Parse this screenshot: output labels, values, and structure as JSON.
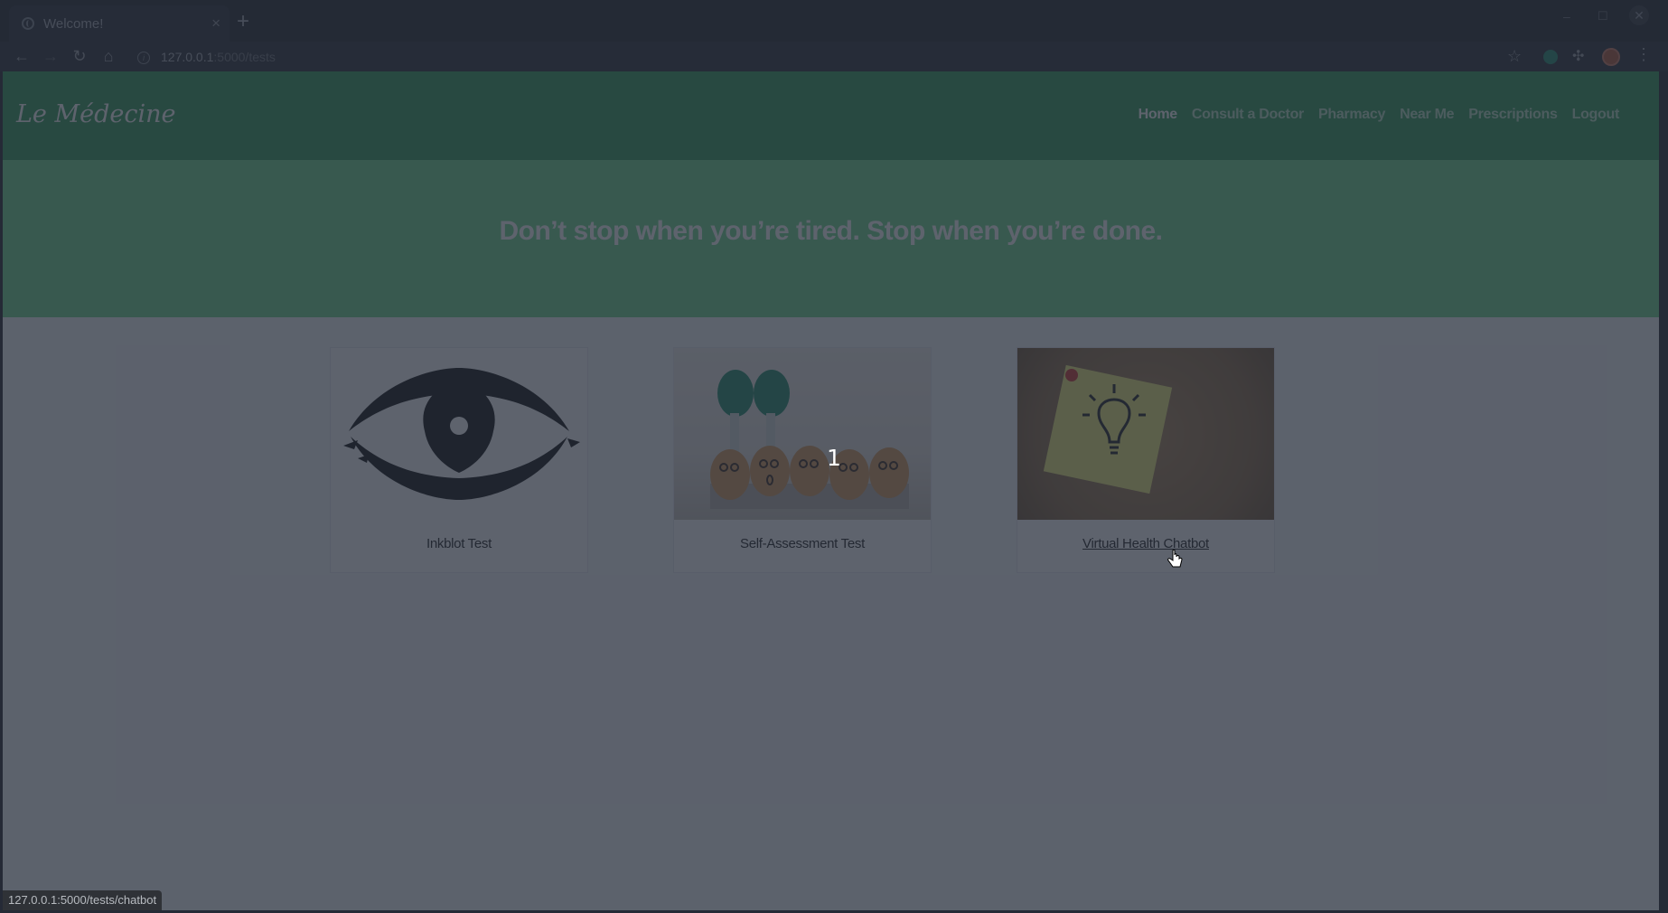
{
  "browser": {
    "tab_title": "Welcome!",
    "url_host": "127.0.0.1",
    "url_rest": ":5000/tests",
    "status_url": "127.0.0.1:5000/tests/chatbot",
    "window_controls": {
      "minimize": "–",
      "maximize": "☐",
      "close": "✕"
    }
  },
  "site": {
    "logo": "Le Médecine",
    "nav": [
      {
        "label": "Home",
        "active": true
      },
      {
        "label": "Consult a Doctor"
      },
      {
        "label": "Pharmacy"
      },
      {
        "label": "Near Me"
      },
      {
        "label": "Prescriptions"
      },
      {
        "label": "Logout"
      }
    ],
    "quote": "Don’t stop when you’re tired. Stop when you’re done."
  },
  "cards": [
    {
      "label": "Inkblot Test",
      "image_icon": "inkblot-eye"
    },
    {
      "label": "Self-Assessment Test",
      "image_icon": "eggs-faces"
    },
    {
      "label": "Virtual Health Chatbot",
      "image_icon": "lightbulb-sticky-note"
    }
  ],
  "overlay_text": "1",
  "colors": {
    "navbar": "#2f9a57",
    "hero": "#6ed68c",
    "overlay": "rgba(38,44,58,0.74)"
  }
}
